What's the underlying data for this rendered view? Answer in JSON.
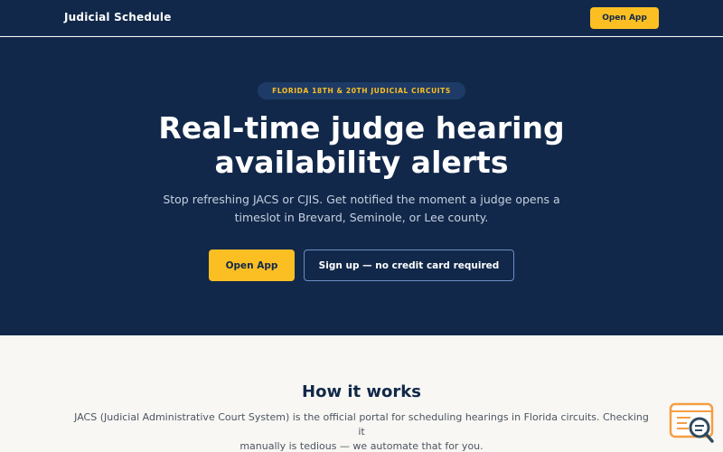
{
  "header": {
    "brand": "Judicial Schedule",
    "open_app_label": "Open App"
  },
  "hero": {
    "badge": "FLORIDA 18TH & 20TH JUDICIAL CIRCUITS",
    "title_line1": "Real-time judge hearing",
    "title_line2": "availability alerts",
    "subtitle_line1": "Stop refreshing JACS or CJIS. Get notified the moment a judge opens a",
    "subtitle_line2": "timeslot in Brevard, Seminole, or Lee county.",
    "primary_button": "Open App",
    "secondary_button": "Sign up — no credit card required"
  },
  "how_it_works": {
    "title": "How it works",
    "text_line1": "JACS (Judicial Administrative Court System) is the official portal for scheduling hearings in Florida circuits. Checking it",
    "text_line2": "manually is tedious — we automate that for you."
  },
  "colors": {
    "navy": "#12284a",
    "accent": "#fbbf24",
    "light_bg": "#f8f7f3"
  },
  "icons": {
    "support": "chat-search-icon"
  }
}
